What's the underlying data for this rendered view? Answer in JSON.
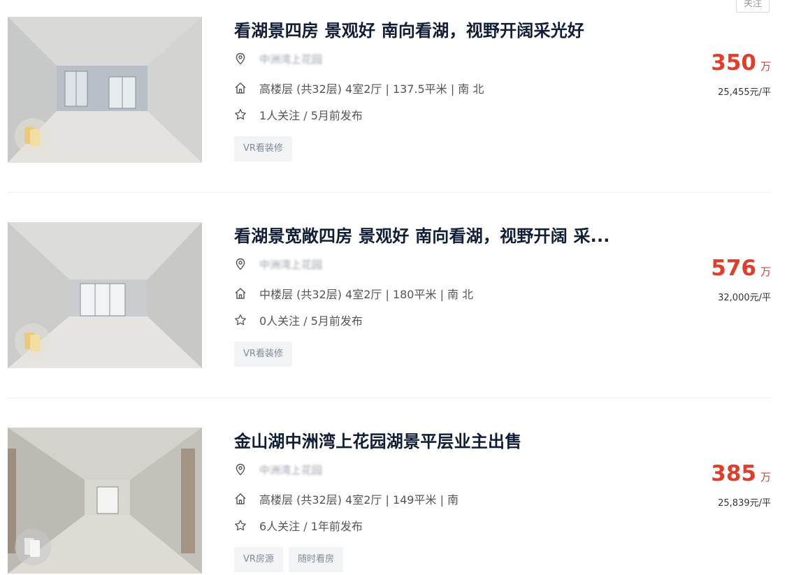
{
  "follow_button": "关注",
  "listings": [
    {
      "title": "看湖景四房 景观好 南向看湖，视野开阔采光好",
      "community": "中洲湾上花园",
      "info": "高楼层 (共32层) 4室2厅 | 137.5平米 | 南 北",
      "followers": "1人关注 / 5月前发布",
      "tags": [
        "VR看装修"
      ],
      "price": "350",
      "price_unit": "万",
      "unit_price": "25,455元/平"
    },
    {
      "title": "看湖景宽敞四房 景观好 南向看湖，视野开阔 采...",
      "community": "中洲湾上花园",
      "info": "中楼层 (共32层) 4室2厅 | 180平米 | 南 北",
      "followers": "0人关注 / 5月前发布",
      "tags": [
        "VR看装修"
      ],
      "price": "576",
      "price_unit": "万",
      "unit_price": "32,000元/平"
    },
    {
      "title": "金山湖中洲湾上花园湖景平层业主出售",
      "community": "中洲湾上花园",
      "info": "高楼层 (共32层) 4室2厅 | 149平米 | 南",
      "followers": "6人关注 / 1年前发布",
      "tags": [
        "VR房源",
        "随时看房"
      ],
      "price": "385",
      "price_unit": "万",
      "unit_price": "25,839元/平"
    }
  ],
  "icons": {
    "location": "location-pin-icon",
    "house": "house-icon",
    "star": "star-icon",
    "vr": "vr-cards-icon"
  },
  "colors": {
    "price": "#e03d2b",
    "title": "#101d37",
    "tag_bg": "#f2f4f6",
    "tag_text": "#7f8b99"
  }
}
